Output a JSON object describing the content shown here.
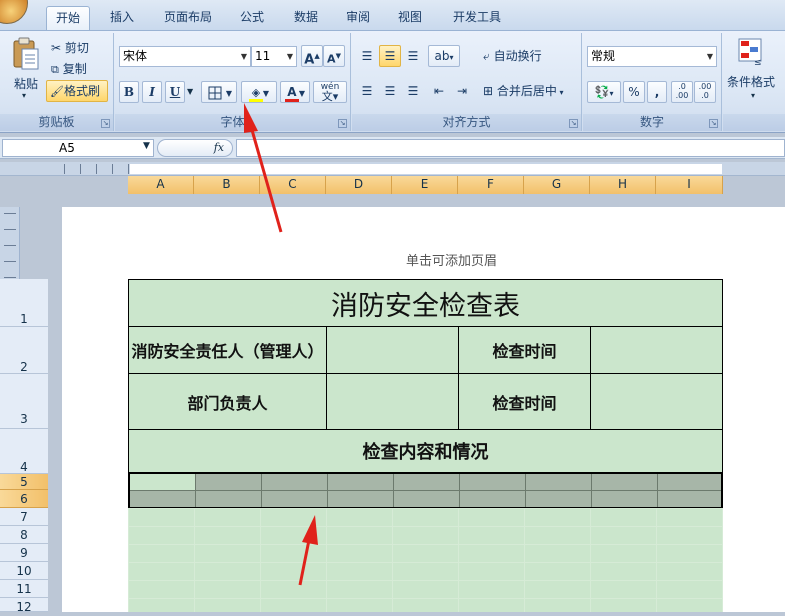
{
  "tabs": [
    "开始",
    "插入",
    "页面布局",
    "公式",
    "数据",
    "审阅",
    "视图",
    "开发工具"
  ],
  "clipboard": {
    "paste": "粘贴",
    "cut": "剪切",
    "copy": "复制",
    "format_painter": "格式刷",
    "label": "剪贴板"
  },
  "font": {
    "name": "宋体",
    "size": "11",
    "bold": "B",
    "italic": "I",
    "underline": "U",
    "label": "字体",
    "phonetic": "wén"
  },
  "alignment": {
    "wrap": "自动换行",
    "merge": "合并后居中",
    "label": "对齐方式"
  },
  "number": {
    "format": "常规",
    "percent": "%",
    "comma": ",",
    "label": "数字",
    "inc": ".0→.00",
    "dec": ".00→.0"
  },
  "styles": {
    "conditional": "条件格式"
  },
  "formula_bar": {
    "name_box": "A5",
    "fx": "fx"
  },
  "columns": [
    "A",
    "B",
    "C",
    "D",
    "E",
    "F",
    "G",
    "H",
    "I"
  ],
  "rows": [
    "1",
    "2",
    "3",
    "4",
    "5",
    "6",
    "7",
    "8",
    "9",
    "10",
    "11",
    "12"
  ],
  "page": {
    "header_hint": "单击可添加页眉"
  },
  "sheet": {
    "title": "消防安全检查表",
    "r2c1": "消防安全责任人（管理人）",
    "r2c3": "检查时间",
    "r3c1": "部门负责人",
    "r3c3": "检查时间",
    "r4": "检查内容和情况"
  },
  "colors": {
    "cell_fill": "#cbe6cc",
    "selected_rows": "#a7b6a8",
    "arrow": "#e0221b"
  }
}
